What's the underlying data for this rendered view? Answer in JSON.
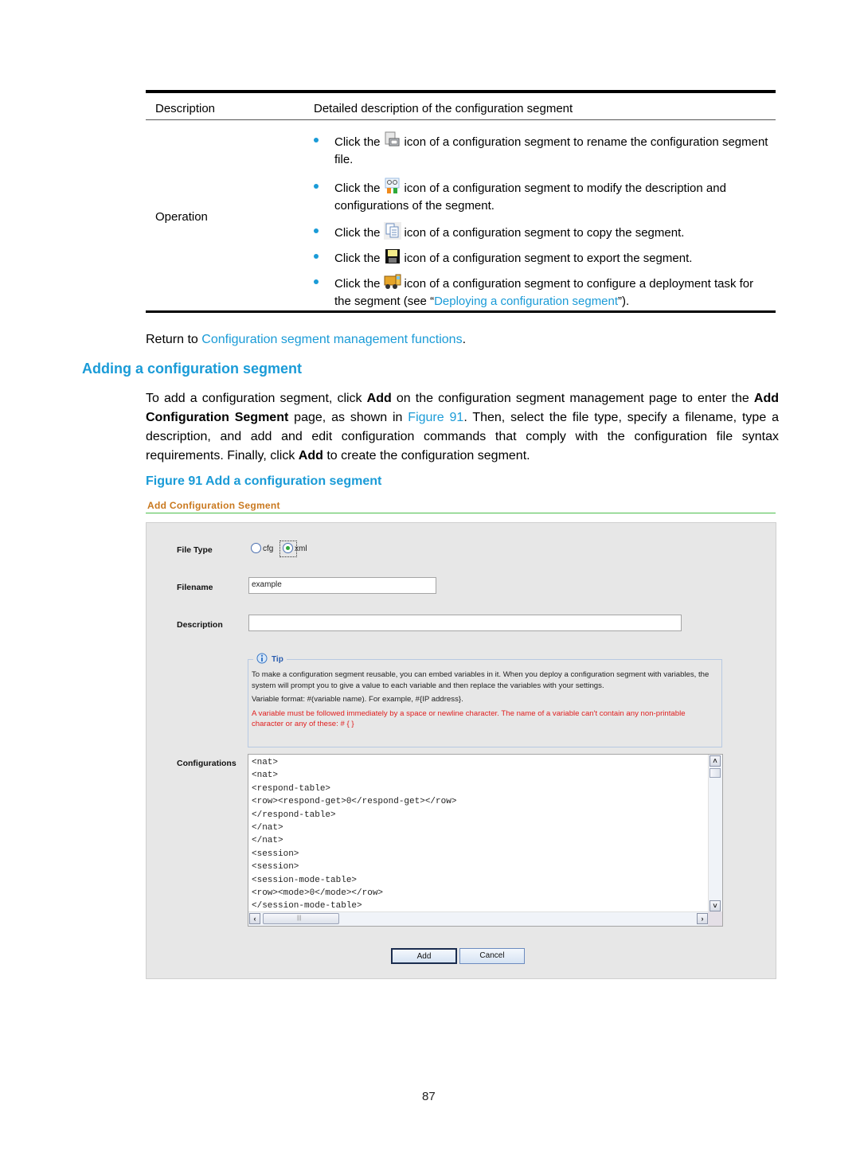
{
  "table": {
    "header": {
      "col1": "Description",
      "col2": "Detailed description of the configuration segment"
    },
    "row_label": "Operation",
    "bullets": [
      {
        "icon": "rename-icon",
        "before": "Click the",
        "after": "icon of a configuration segment to rename the configuration segment file."
      },
      {
        "icon": "modify-icon",
        "before": "Click the",
        "after": "icon of a configuration segment to modify the description and configurations of the segment."
      },
      {
        "icon": "copy-icon",
        "before": "Click the",
        "after": "icon of a configuration segment to copy the segment."
      },
      {
        "icon": "export-floppy-icon",
        "before": "Click the",
        "after": "icon of a configuration segment to export the segment."
      },
      {
        "icon": "deploy-truck-icon",
        "before": "Click the",
        "after": "icon of a configuration segment to configure a deployment task for the segment (see “",
        "link": "Deploying a configuration segment",
        "tail": "”)."
      }
    ]
  },
  "return_line": {
    "prefix": "Return to ",
    "link": "Configuration segment management functions",
    "suffix": "."
  },
  "section_heading": "Adding a configuration segment",
  "paragraph": {
    "p1": "To add a configuration segment, click ",
    "b1": "Add",
    "p2": " on the configuration segment management page to enter the ",
    "b2": "Add Configuration Segment",
    "p3": " page, as shown in ",
    "link": "Figure 91",
    "p4": ". Then, select the file type, specify a filename, type a description, and add and edit configuration commands that comply with the configuration file syntax requirements. Finally, click ",
    "b3": "Add",
    "p5": " to create the configuration segment."
  },
  "figure_caption": "Figure 91 Add a configuration segment",
  "figure": {
    "title": "Add Configuration Segment",
    "file_type_label": "File Type",
    "file_type_options": [
      "cfg",
      "xml"
    ],
    "file_type_selected": "xml",
    "filename_label": "Filename",
    "filename_value": "example",
    "description_label": "Description",
    "description_value": "",
    "tip": {
      "title": "Tip",
      "line1": "To make a configuration segment reusable, you can embed variables in it. When you deploy a configuration segment with variables, the system will prompt you to give a value to each variable and then replace the variables with your settings.",
      "line2": "Variable format: #(variable name). For example, #{IP address}.",
      "warning": "A variable must be followed immediately by a space or newline character. The name of a variable can't contain any non-printable character or any of these: # { }"
    },
    "configurations_label": "Configurations",
    "configurations_value": "<nat>\n<nat>\n<respond-table>\n<row><respond-get>0</respond-get></row>\n</respond-table>\n</nat>\n</nat>\n<session>\n<session>\n<session-mode-table>\n<row><mode>0</mode></row>\n</session-mode-table>",
    "add_button": "Add",
    "cancel_button": "Cancel"
  },
  "page_number": "87",
  "colors": {
    "link": "#1a9bd7",
    "figure_title": "#c9781e",
    "warning": "#e02020",
    "green_rule": "#4bbf4b"
  }
}
